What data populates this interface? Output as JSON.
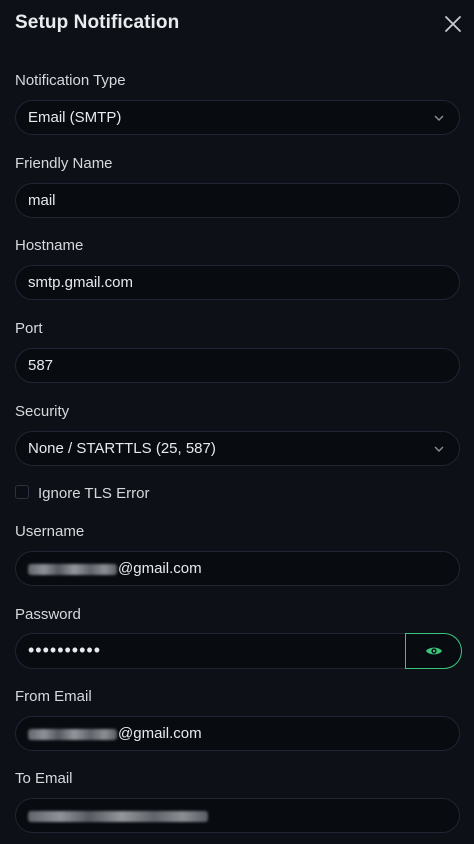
{
  "dialog": {
    "title": "Setup Notification"
  },
  "fields": {
    "notification_type": {
      "label": "Notification Type",
      "value": "Email (SMTP)"
    },
    "friendly_name": {
      "label": "Friendly Name",
      "value": "mail"
    },
    "hostname": {
      "label": "Hostname",
      "value": "smtp.gmail.com"
    },
    "port": {
      "label": "Port",
      "value": "587"
    },
    "security": {
      "label": "Security",
      "value": "None / STARTTLS (25, 587)"
    },
    "ignore_tls": {
      "label": "Ignore TLS Error",
      "checked": false
    },
    "username": {
      "label": "Username",
      "value_suffix": "@gmail.com"
    },
    "password": {
      "label": "Password",
      "value": "••••••••••"
    },
    "from_email": {
      "label": "From Email",
      "value_suffix": "@gmail.com"
    },
    "to_email": {
      "label": "To Email"
    }
  },
  "colors": {
    "background": "#0d1117",
    "input_bg": "#080b10",
    "input_border": "#1e2633",
    "accent": "#3cc47a"
  },
  "icons": {
    "close": "close-icon",
    "dropdown": "chevron-down-icon",
    "reveal_password": "eye-icon"
  }
}
